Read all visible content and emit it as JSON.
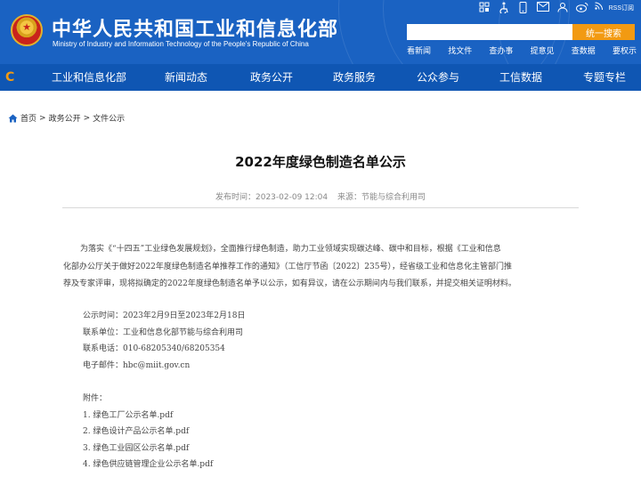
{
  "header": {
    "title": "中华人民共和国工业和信息化部",
    "subtitle": "Ministry of Industry and Information Technology of the People's Republic of China",
    "rss_label": "RSS订阅",
    "search": {
      "placeholder": "",
      "button_label": "统一搜索"
    },
    "quick_links": [
      "看新闻",
      "找文件",
      "查办事",
      "提意见",
      "查数据",
      "要权示"
    ]
  },
  "nav": {
    "items": [
      "工业和信息化部",
      "新闻动态",
      "政务公开",
      "政务服务",
      "公众参与",
      "工信数据",
      "专题专栏"
    ]
  },
  "breadcrumb": [
    "首页",
    "政务公开",
    "文件公示"
  ],
  "article": {
    "title": "2022年度绿色制造名单公示",
    "publish_label": "发布时间：2023-02-09 12:04",
    "source_label": "来源：节能与综合利用司",
    "paragraph_lines": [
      "为落实《“十四五”工业绿色发展规划》，全面推行绿色制造，助力工业领域实现碳达峰、碳中和目标，根据《工业和信息",
      "化部办公厅关于做好2022年度绿色制造名单推荐工作的通知》（工信厅节函〔2022〕235号），经省级工业和信息化主管部门推",
      "荐及专家评审，现将拟确定的2022年度绿色制造名单予以公示，如有异议，请在公示期间内与我们联系，并提交相关证明材料。"
    ],
    "contact": [
      "公示时间：2023年2月9日至2023年2月18日",
      "联系单位：工业和信息化部节能与综合利用司",
      "联系电话：010-68205340/68205354",
      "电子邮件：hbc@miit.gov.cn"
    ],
    "attachments_label": "附件：",
    "attachments": [
      "1. 绿色工厂公示名单.pdf",
      "2. 绿色设计产品公示名单.pdf",
      "3. 绿色工业园区公示名单.pdf",
      "4. 绿色供应链管理企业公示名单.pdf"
    ]
  },
  "colors": {
    "header_blue": "#1a62c2",
    "nav_blue": "#0f56b3",
    "search_orange": "#f29a12"
  },
  "icons": [
    "emblem-icon",
    "accessibility-icon",
    "mobile-icon",
    "mail-icon",
    "user-icon",
    "weibo-icon",
    "rss-icon",
    "home-icon"
  ]
}
